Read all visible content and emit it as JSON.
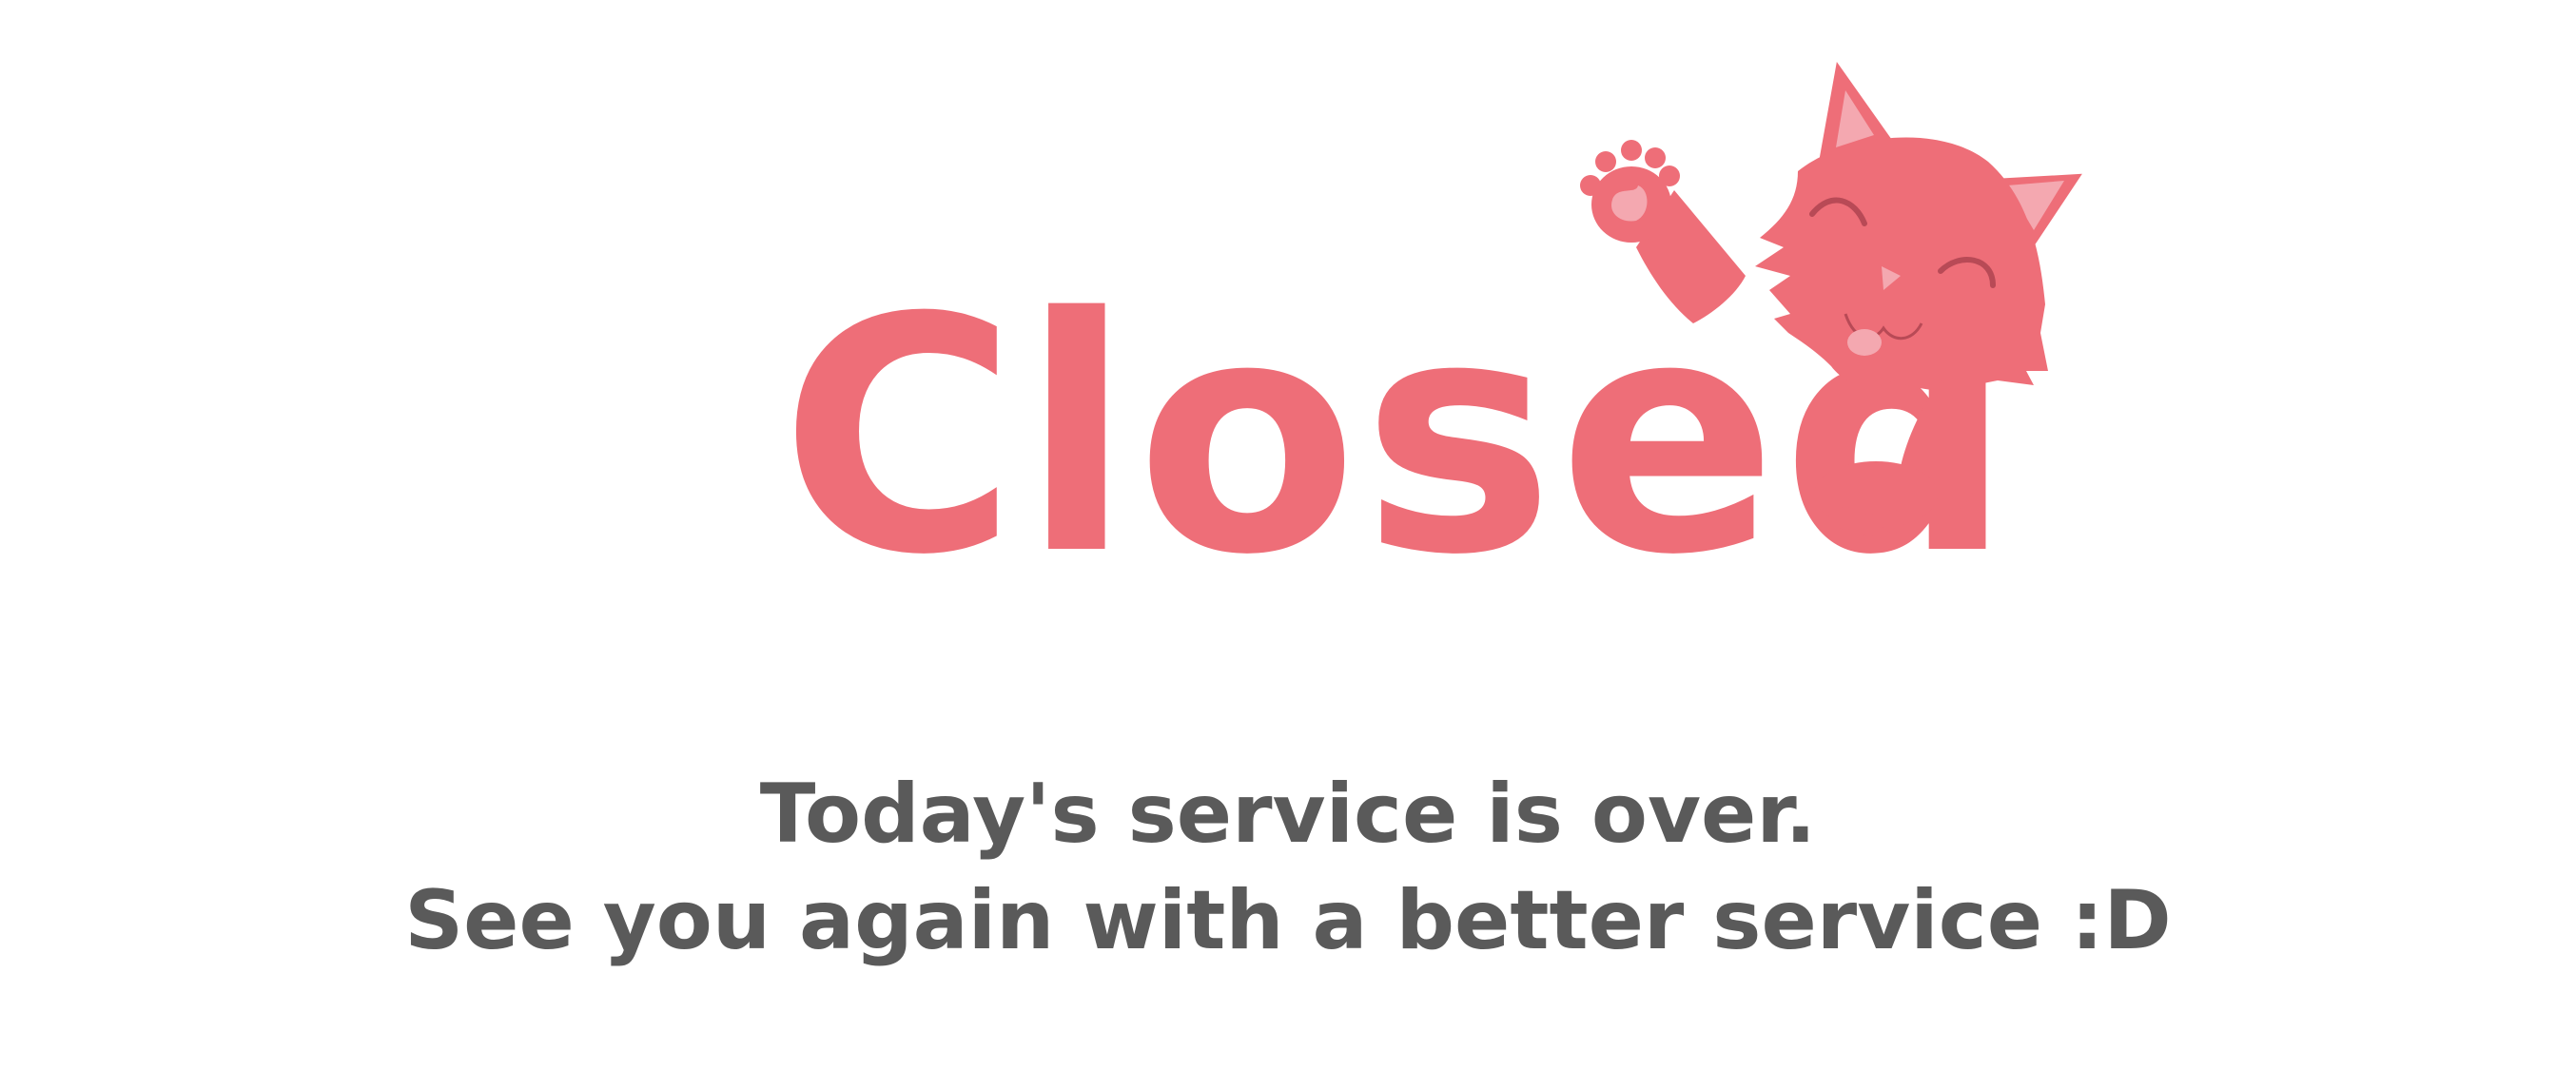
{
  "heading": {
    "title": "Closed"
  },
  "mascot": {
    "icon": "waving-cat-icon",
    "color": "#ee6e78",
    "accent_color": "#f4a8b0"
  },
  "message": {
    "line1": "Today's service is over.",
    "line2": "See you again with a better service :D"
  },
  "colors": {
    "title": "#ee6e78",
    "text": "#5a5a5a",
    "background": "#ffffff"
  }
}
